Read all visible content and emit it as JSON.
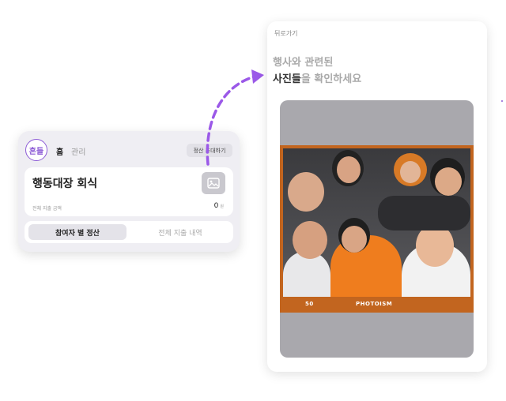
{
  "event_card": {
    "logo_text": "흔들",
    "nav": {
      "home": "홈",
      "manage": "관리"
    },
    "invite_button": "정산 초대하기",
    "event_title": "행동대장 회식",
    "total_spend_label": "전체 지출 금액",
    "total_spend_value": "0",
    "currency_unit": "원",
    "tabs": [
      {
        "label": "참여자 별 정산",
        "active": true
      },
      {
        "label": "전체 지출 내역",
        "active": false
      }
    ]
  },
  "photo_panel": {
    "back_label": "뒤로가기",
    "heading_line1": "행사와 관련된",
    "heading_bold": "사진들",
    "heading_rest": "을 확인하세요",
    "photo_caption_left": "50",
    "photo_caption_right": "PHOTOISM"
  },
  "colors": {
    "accent": "#8d5cd6",
    "arrow": "#9b59e8",
    "strip": "#c2651f"
  }
}
